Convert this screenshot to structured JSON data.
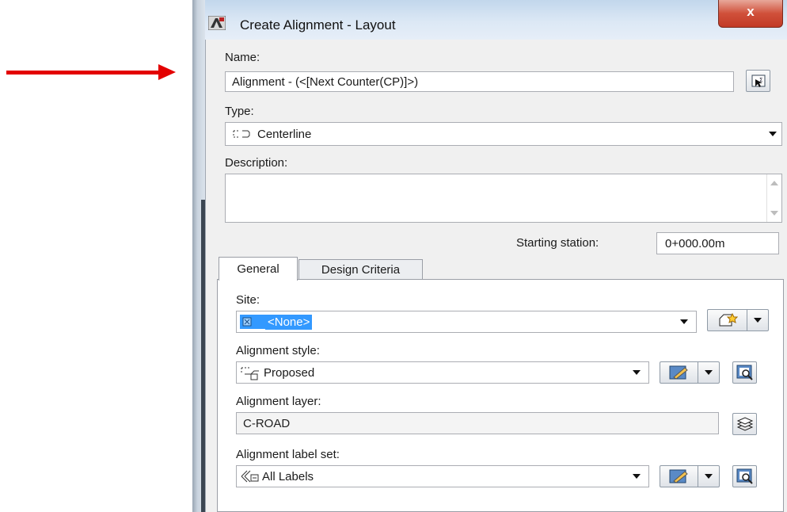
{
  "window": {
    "title": "Create Alignment - Layout",
    "close_glyph": "x"
  },
  "name": {
    "label": "Name:",
    "value": "Alignment - (<[Next Counter(CP)]>)"
  },
  "type": {
    "label": "Type:",
    "value": "Centerline"
  },
  "description": {
    "label": "Description:",
    "value": ""
  },
  "starting_station": {
    "label": "Starting station:",
    "value": "0+000.00m"
  },
  "tabs": [
    {
      "label": "General"
    },
    {
      "label": "Design Criteria"
    }
  ],
  "general": {
    "site": {
      "label": "Site:",
      "value": "<None>"
    },
    "alignment_style": {
      "label": "Alignment style:",
      "value": "Proposed"
    },
    "alignment_layer": {
      "label": "Alignment layer:",
      "value": "C-ROAD"
    },
    "alignment_label_set": {
      "label": "Alignment label set:",
      "value": "All Labels"
    }
  },
  "colors": {
    "annotation_arrow": "#e30000",
    "selection": "#3399ff",
    "close_button": "#c23a26"
  },
  "icons": [
    "autocad-civil-app-icon",
    "pick-from-drawing-icon",
    "centerline-type-icon",
    "site-icon",
    "create-site-icon",
    "alignment-style-icon",
    "edit-style-icon",
    "browse-style-icon",
    "layer-icon",
    "label-set-icon"
  ]
}
